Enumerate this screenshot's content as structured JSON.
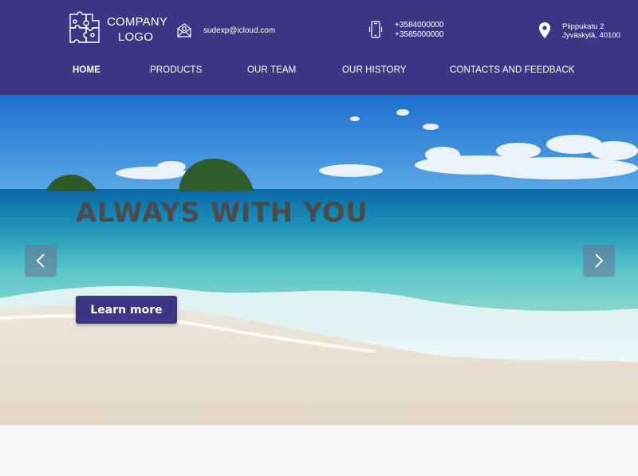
{
  "header": {
    "logo": {
      "line1": "COMPANY",
      "line2": "LOGO",
      "icon": "puzzle-icon"
    },
    "email": {
      "icon": "envelope-icon",
      "text": "sudexp@icloud.com"
    },
    "phones": {
      "icon": "phone-icon",
      "line1": "+3584000000",
      "line2": "+3585000000"
    },
    "address": {
      "icon": "location-pin-icon",
      "line1": "Piippukatu 2",
      "line2": "Jyväskylä, 40100"
    }
  },
  "nav": {
    "items": [
      {
        "label": "HOME",
        "active": true
      },
      {
        "label": "PRODUCTS",
        "active": false
      },
      {
        "label": "OUR TEAM",
        "active": false
      },
      {
        "label": "OUR HISTORY",
        "active": false
      },
      {
        "label": "CONTACTS AND FEEDBACK",
        "active": false
      }
    ]
  },
  "hero": {
    "headline": "ALWAYS WITH YOU",
    "button_label": "Learn more",
    "prev_icon": "chevron-left-icon",
    "next_icon": "chevron-right-icon"
  },
  "colors": {
    "brand": "#3d3685",
    "headline": "#4b4b4b"
  }
}
